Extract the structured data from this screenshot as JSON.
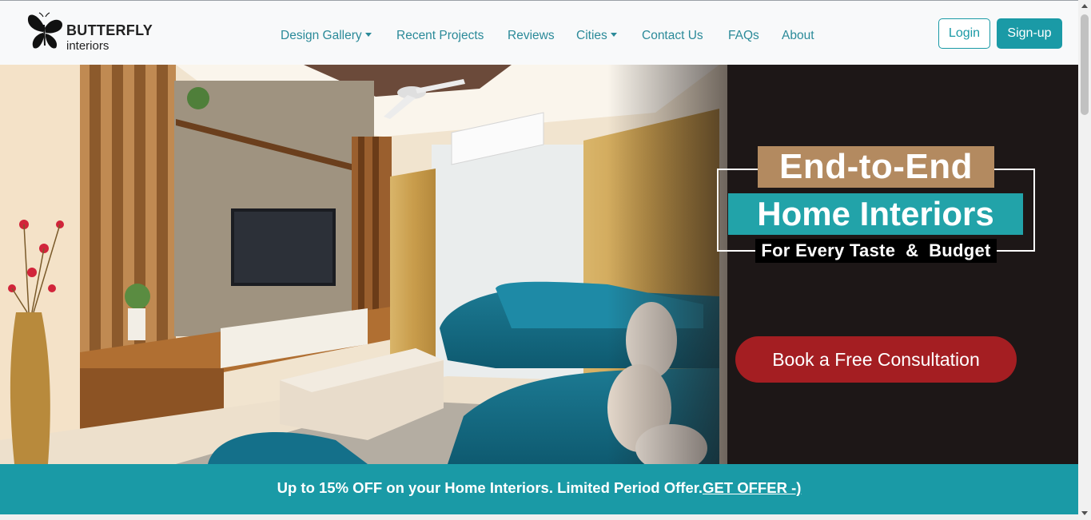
{
  "brand": {
    "name": "BUTTERFLY",
    "tagline": "interiors",
    "icon": "butterfly-icon"
  },
  "nav": {
    "items": [
      {
        "label": "Design Gallery",
        "dropdown": true
      },
      {
        "label": "Recent Projects",
        "dropdown": false
      },
      {
        "label": "Reviews",
        "dropdown": false
      },
      {
        "label": "Cities",
        "dropdown": true
      },
      {
        "label": "Contact Us",
        "dropdown": false
      },
      {
        "label": "FAQs",
        "dropdown": false
      },
      {
        "label": "About",
        "dropdown": false
      }
    ],
    "login_label": "Login",
    "signup_label": "Sign-up"
  },
  "hero": {
    "headline_1": "End-to-End",
    "headline_2": "Home Interiors",
    "headline_3": "For Every Taste  &  Budget",
    "cta_label": "Book a Free Consultation"
  },
  "offer": {
    "text": "Up to 15% OFF on your Home Interiors. Limited Period Offer.",
    "link_label": "GET OFFER -)"
  },
  "colors": {
    "accent": "#1a9aa6",
    "nav_link": "#2b8a99",
    "cta": "#a41e22",
    "headline_tan": "#b38a60",
    "headline_teal": "#22a3a9"
  }
}
